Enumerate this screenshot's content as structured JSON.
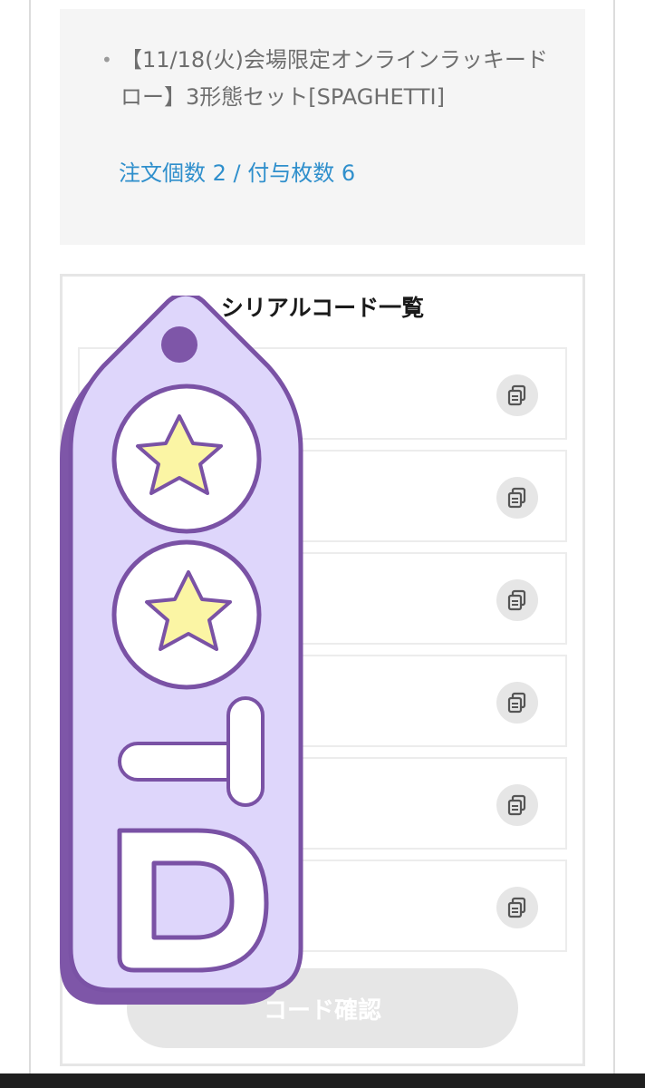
{
  "order": {
    "bullet": "•",
    "item_title": "【11/18(火)会場限定オンラインラッキードロー】3形態セット[SPAGHETTI]",
    "quantity_text": "注文個数 2 / 付与枚数 6"
  },
  "serial": {
    "title": "シリアルコード一覧",
    "codes": [
      "",
      "",
      "",
      "",
      "",
      ""
    ],
    "confirm_label": "コード確認"
  },
  "sticker": {
    "text": "TD",
    "colors": {
      "tag": "#ded6fb",
      "shadow": "#7e56a8",
      "outline": "#7a52a5",
      "star": "#fbf5a4"
    }
  },
  "colors": {
    "link": "#2f8fcc",
    "panel_bg": "#f5f5f5",
    "button_bg": "#e6e6e6"
  }
}
